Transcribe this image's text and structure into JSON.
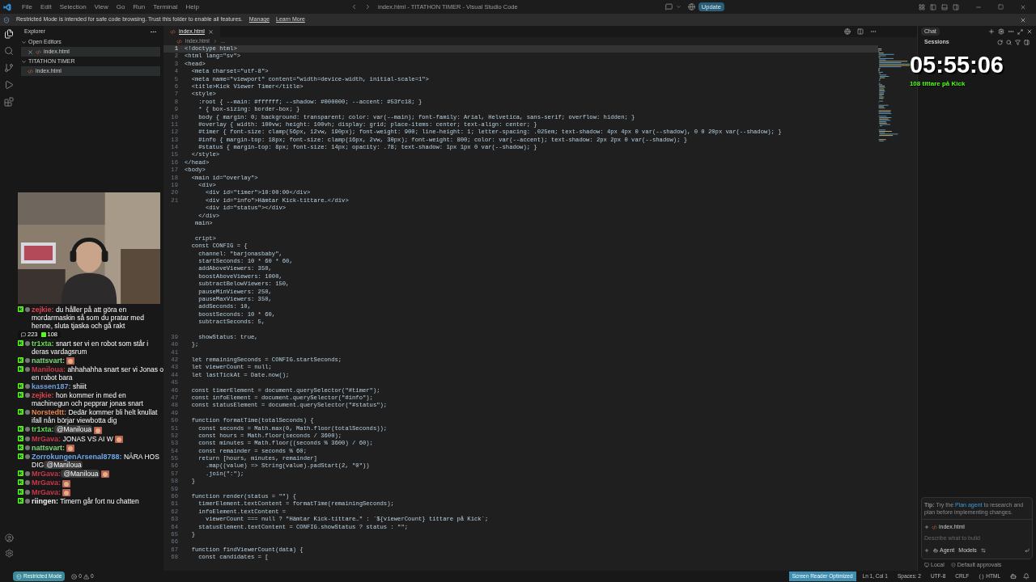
{
  "title_bar": {
    "menu": [
      "File",
      "Edit",
      "Selection",
      "View",
      "Go",
      "Run",
      "Terminal",
      "Help"
    ],
    "title": "index.html - TITATHON TIMER - Visual Studio Code",
    "update_button": "Update"
  },
  "banner": {
    "message": "Restricted Mode is intended for safe code browsing. Trust this folder to enable all features.",
    "links": [
      "Manage",
      "Learn More"
    ]
  },
  "activity_bar": [
    {
      "kind": "explorer",
      "selected": true
    },
    {
      "kind": "search",
      "selected": false
    },
    {
      "kind": "source-control",
      "selected": false
    },
    {
      "kind": "run",
      "selected": false
    },
    {
      "kind": "extensions",
      "selected": false
    }
  ],
  "sidebar": {
    "title": "Explorer",
    "sections": [
      {
        "title": "Open Editors",
        "items": [
          {
            "label": "index.html",
            "closable": true,
            "selected": true
          }
        ]
      },
      {
        "title": "TITATHON TIMER",
        "items": [
          {
            "label": "index.html",
            "closable": false,
            "selected": true
          }
        ]
      }
    ]
  },
  "editor": {
    "tabs": [
      {
        "label": "index.html",
        "selected": true
      }
    ],
    "breadcrumb": [
      "index.html",
      "..."
    ],
    "lines": [
      {
        "n": "1",
        "code": "<!doctype html>",
        "current": true
      },
      {
        "n": "2",
        "code": "<html lang=\"sv\">",
        "current": false
      },
      {
        "n": "3",
        "code": "<head>",
        "current": false
      },
      {
        "n": "4",
        "code": "  <meta charset=\"utf-8\">",
        "current": false
      },
      {
        "n": "5",
        "code": "  <meta name=\"viewport\" content=\"width=device-width, initial-scale=1\">",
        "current": false
      },
      {
        "n": "6",
        "code": "  <title>Kick Viewer Timer</title>",
        "current": false
      },
      {
        "n": "7",
        "code": "  <style>",
        "current": false
      },
      {
        "n": "8",
        "code": "    :root { --main: #ffffff; --shadow: #000000; --accent: #53fc18; }",
        "current": false
      },
      {
        "n": "9",
        "code": "    * { box-sizing: border-box; }",
        "current": false
      },
      {
        "n": "10",
        "code": "    body { margin: 0; background: transparent; color: var(--main); font-family: Arial, Helvetica, sans-serif; overflow: hidden; }",
        "current": false
      },
      {
        "n": "11",
        "code": "    #overlay { width: 100vw; height: 100vh; display: grid; place-items: center; text-align: center; }",
        "current": false
      },
      {
        "n": "12",
        "code": "    #timer { font-size: clamp(56px, 12vw, 190px); font-weight: 900; line-height: 1; letter-spacing: .025em; text-shadow: 4px 4px 0 var(--shadow), 0 0 20px var(--shadow); }",
        "current": false
      },
      {
        "n": "13",
        "code": "    #info { margin-top: 18px; font-size: clamp(16px, 2vw, 30px); font-weight: 800; color: var(--accent); text-shadow: 2px 2px 0 var(--shadow); }",
        "current": false
      },
      {
        "n": "14",
        "code": "    #status { margin-top: 8px; font-size: 14px; opacity: .78; text-shadow: 1px 1px 0 var(--shadow); }",
        "current": false
      },
      {
        "n": "15",
        "code": "  </style>",
        "current": false
      },
      {
        "n": "16",
        "code": "</head>",
        "current": false
      },
      {
        "n": "17",
        "code": "<body>",
        "current": false
      },
      {
        "n": "18",
        "code": "  <main id=\"overlay\">",
        "current": false
      },
      {
        "n": "19",
        "code": "    <div>",
        "current": false
      },
      {
        "n": "20",
        "code": "      <div id=\"timer\">10:00:00</div>",
        "current": false
      },
      {
        "n": "21",
        "code": "      <div id=\"info\">Hämtar Kick-tittare…</div>",
        "current": false
      },
      {
        "code": "      <div id=\"status\"></div>",
        "current": false
      },
      {
        "code": "    </div>",
        "current": false
      },
      {
        "code": "   main>",
        "current": false
      },
      {
        "current": false
      },
      {
        "code": "   cript>",
        "current": false
      },
      {
        "code": "  const CONFIG = {",
        "current": false
      },
      {
        "code": "    channel: \"barjonasbaby\",",
        "current": false
      },
      {
        "code": "    startSeconds: 10 * 60 * 60,",
        "current": false
      },
      {
        "code": "    addAboveViewers: 350,",
        "current": false
      },
      {
        "code": "    boostAboveViewers: 1000,",
        "current": false
      },
      {
        "code": "    subtractBelowViewers: 150,",
        "current": false
      },
      {
        "code": "    pauseMinViewers: 250,",
        "current": false
      },
      {
        "code": "    pauseMaxViewers: 350,",
        "current": false
      },
      {
        "code": "    addSeconds: 10,",
        "current": false
      },
      {
        "code": "    boostSeconds: 10 * 60,",
        "current": false
      },
      {
        "code": "    subtractSeconds: 5,",
        "current": false
      },
      {
        "current": false
      },
      {
        "n": "39",
        "code": "    showStatus: true,",
        "current": false
      },
      {
        "n": "40",
        "code": "  };",
        "current": false
      },
      {
        "n": "41",
        "current": false
      },
      {
        "n": "42",
        "code": "  let remainingSeconds = CONFIG.startSeconds;",
        "current": false
      },
      {
        "n": "43",
        "code": "  let viewerCount = null;",
        "current": false
      },
      {
        "n": "44",
        "code": "  let lastTickAt = Date.now();",
        "current": false
      },
      {
        "n": "45",
        "current": false
      },
      {
        "n": "46",
        "code": "  const timerElement = document.querySelector(\"#timer\");",
        "current": false
      },
      {
        "n": "47",
        "code": "  const infoElement = document.querySelector(\"#info\");",
        "current": false
      },
      {
        "n": "48",
        "code": "  const statusElement = document.querySelector(\"#status\");",
        "current": false
      },
      {
        "n": "49",
        "current": false
      },
      {
        "n": "50",
        "code": "  function formatTime(totalSeconds) {",
        "current": false
      },
      {
        "n": "51",
        "code": "    const seconds = Math.max(0, Math.floor(totalSeconds));",
        "current": false
      },
      {
        "n": "52",
        "code": "    const hours = Math.floor(seconds / 3600);",
        "current": false
      },
      {
        "n": "53",
        "code": "    const minutes = Math.floor((seconds % 3600) / 60);",
        "current": false
      },
      {
        "n": "54",
        "code": "    const remainder = seconds % 60;",
        "current": false
      },
      {
        "n": "55",
        "code": "    return [hours, minutes, remainder]",
        "current": false
      },
      {
        "n": "56",
        "code": "      .map((value) => String(value).padStart(2, \"0\"))",
        "current": false
      },
      {
        "n": "57",
        "code": "      .join(\":\");",
        "current": false
      },
      {
        "n": "58",
        "code": "  }",
        "current": false
      },
      {
        "n": "59",
        "current": false
      },
      {
        "n": "60",
        "code": "  function render(status = \"\") {",
        "current": false
      },
      {
        "n": "61",
        "code": "    timerElement.textContent = formatTime(remainingSeconds);",
        "current": false
      },
      {
        "n": "62",
        "code": "    infoElement.textContent =",
        "current": false
      },
      {
        "n": "63",
        "code": "      viewerCount === null ? \"Hämtar Kick-tittare…\" : `${viewerCount} tittare på Kick`;",
        "current": false
      },
      {
        "n": "64",
        "code": "    statusElement.textContent = CONFIG.showStatus ? status : \"\";",
        "current": false
      },
      {
        "n": "65",
        "code": "  }",
        "current": false
      },
      {
        "n": "66",
        "current": false
      },
      {
        "n": "67",
        "code": "  function findViewerCount(data) {",
        "current": false
      },
      {
        "n": "68",
        "code": "    const candidates = [",
        "current": false
      }
    ]
  },
  "chat_panel": {
    "tab": "Chat",
    "heading": "Sessions",
    "tip": {
      "before": "**Tip:** Try the",
      "link": "Plan agent",
      "after": "to research and plan before implementing changes."
    },
    "attachment": "index.html",
    "input": {
      "placeholder": "Describe what to build"
    },
    "mode": "Agent",
    "models": "Models",
    "footer": [
      "Local",
      "Default approvals"
    ]
  },
  "status_bar": {
    "mode": "Restricted Mode",
    "errors": "0",
    "warnings": "0",
    "items": [
      {
        "kind": "badge",
        "text": "Screen Reader Optimized"
      },
      {
        "kind": "text",
        "text": "Ln 1, Col 1"
      },
      {
        "kind": "text",
        "text": "Spaces: 2"
      },
      {
        "kind": "text",
        "text": "UTF-8"
      },
      {
        "kind": "text",
        "text": "CRLF"
      },
      {
        "kind": "language",
        "text": "HTML"
      }
    ]
  },
  "overlays": {
    "timer": "05:55:06",
    "viewers": "108 tittare på Kick",
    "stream_chat": {
      "stats": [
        {
          "kind": "chat",
          "value": "223"
        },
        {
          "kind": "kick",
          "value": "108"
        }
      ],
      "messages": [
        {
          "user": "zejkie:",
          "color": "#d9434f",
          "text": "du håller på att göra en mordarmaskin så som du pratar med henne, sluta tjaska och gå rakt",
          "emote": false
        },
        {
          "user": "tr1xta:",
          "color": "#66dd55",
          "text": "snart ser vi en robot som står i deras vardagsrum",
          "emote": false
        },
        {
          "user": "nattsvart:",
          "color": "#7ed87a",
          "emote": true
        },
        {
          "user": "Maniloua:",
          "color": "#c8384a",
          "text": "ahhahahha snart ser vi Jonas o en robot bara",
          "emote": false
        },
        {
          "user": "kassen187:",
          "color": "#6f9fe0",
          "text": "shiiit",
          "emote": false
        },
        {
          "user": "zejkie:",
          "color": "#d9434f",
          "text": "hon kommer in med en machinegun och pepprar jonas snart",
          "emote": false
        },
        {
          "user": "Norstedtt:",
          "color": "#e8844a",
          "text": "Dedär kommer bli helt knullat ifall nån börjar viewbotta dig",
          "emote": false
        },
        {
          "user": "tr1xta:",
          "color": "#66dd55",
          "mention": "@Maniloua",
          "emote": true
        },
        {
          "user": "MrGava:",
          "color": "#c8384a",
          "text": "JONAS VS AI W",
          "emote": true
        },
        {
          "user": "nattsvart:",
          "color": "#7ed87a",
          "emote": true
        },
        {
          "user": "ZorrokungenArsenal8788:",
          "color": "#6fa6e8",
          "text": "NÄRA HOS DIG",
          "mention": "@Maniloua",
          "emote": false
        },
        {
          "user": "MrGava:",
          "color": "#c8384a",
          "mention": "@Maniloua",
          "emote": true
        },
        {
          "user": "MrGava:",
          "color": "#c8384a",
          "emote": true
        },
        {
          "user": "MrGava:",
          "color": "#c8384a",
          "emote": true
        },
        {
          "user": "riingen:",
          "color": "#f2f2f2",
          "text": "Timern går fort nu chatten",
          "emote": false
        }
      ]
    }
  }
}
